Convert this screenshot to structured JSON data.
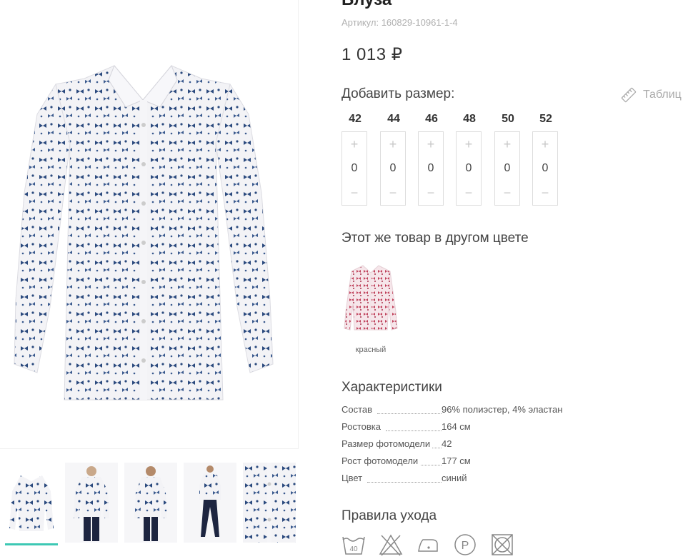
{
  "product": {
    "title": "Блуза",
    "sku": "Артикул: 160829-10961-1-4",
    "price": "1 013 ₽"
  },
  "sizes": {
    "heading": "Добавить размер:",
    "table_link": "Таблиц",
    "items": [
      {
        "size": "42",
        "qty": "0"
      },
      {
        "size": "44",
        "qty": "0"
      },
      {
        "size": "46",
        "qty": "0"
      },
      {
        "size": "48",
        "qty": "0"
      },
      {
        "size": "50",
        "qty": "0"
      },
      {
        "size": "52",
        "qty": "0"
      }
    ],
    "plus": "+",
    "minus": "−"
  },
  "other_color": {
    "heading": "Этот же товар в другом цвете",
    "items": [
      {
        "label": "красный",
        "color": "#c0405a"
      }
    ]
  },
  "specs": {
    "heading": "Характеристики",
    "rows": [
      {
        "key": "Состав",
        "value": "96% полиэстер, 4% эластан"
      },
      {
        "key": "Ростовка",
        "value": "164 см"
      },
      {
        "key": "Размер фотомодели",
        "value": "42"
      },
      {
        "key": "Рост фотомодели",
        "value": "177 см"
      },
      {
        "key": "Цвет",
        "value": "синий"
      }
    ]
  },
  "care": {
    "heading": "Правила ухода",
    "wash_temp": "40",
    "icons": [
      "wash-40-icon",
      "no-bleach-icon",
      "iron-low-icon",
      "dry-clean-p-icon",
      "no-tumble-dry-icon"
    ]
  },
  "gallery": {
    "active_index": 0,
    "thumb_count": 5
  },
  "colors": {
    "accent": "#3dc8b4",
    "print_blue": "#2b4a7e",
    "text_muted": "#b0b0b0"
  }
}
